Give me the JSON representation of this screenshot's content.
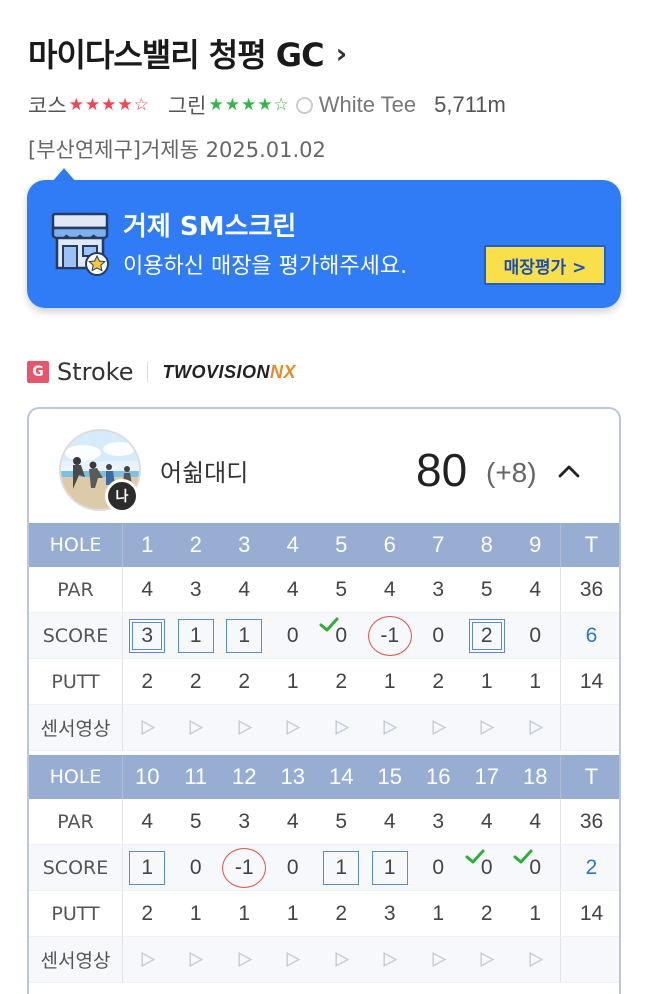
{
  "course": {
    "title": "마이다스밸리 청평 GC",
    "course_label": "코스",
    "course_stars": "★★★★☆",
    "green_label": "그린",
    "green_stars": "★★★★☆",
    "tee": "White Tee",
    "distance": "5,711m",
    "location_date": "[부산연제구]거제동 2025.01.02"
  },
  "banner": {
    "store_name": "거제 SM스크린",
    "message": "이용하신 매장을 평가해주세요.",
    "button_label": "매장평가 >"
  },
  "mode": {
    "badge": "G",
    "label": "Stroke",
    "brand": "TWOVISION",
    "brand_suffix": "NX"
  },
  "player": {
    "name": "어쉶대디",
    "badge": "나",
    "score": "80",
    "over_par": "(+8)"
  },
  "labels": {
    "hole": "HOLE",
    "par": "PAR",
    "score": "SCORE",
    "putt": "PUTT",
    "video": "센서영상",
    "total": "T"
  },
  "front_nine": {
    "holes": [
      "1",
      "2",
      "3",
      "4",
      "5",
      "6",
      "7",
      "8",
      "9"
    ],
    "par": [
      "4",
      "3",
      "4",
      "4",
      "5",
      "4",
      "3",
      "5",
      "4"
    ],
    "score": [
      "3",
      "1",
      "1",
      "0",
      "0",
      "-1",
      "0",
      "2",
      "0"
    ],
    "score_marks": [
      "double-box",
      "box",
      "box",
      "none",
      "check",
      "circle",
      "none",
      "double-box",
      "none"
    ],
    "putt": [
      "2",
      "2",
      "2",
      "1",
      "2",
      "1",
      "2",
      "1",
      "1"
    ],
    "total_par": "36",
    "total_score": "6",
    "total_putt": "14"
  },
  "back_nine": {
    "holes": [
      "10",
      "11",
      "12",
      "13",
      "14",
      "15",
      "16",
      "17",
      "18"
    ],
    "par": [
      "4",
      "5",
      "3",
      "4",
      "5",
      "4",
      "3",
      "4",
      "4"
    ],
    "score": [
      "1",
      "0",
      "-1",
      "0",
      "1",
      "1",
      "0",
      "0",
      "0"
    ],
    "score_marks": [
      "box",
      "none",
      "circle",
      "none",
      "box",
      "box",
      "none",
      "check",
      "check"
    ],
    "putt": [
      "2",
      "1",
      "1",
      "1",
      "2",
      "3",
      "1",
      "2",
      "1"
    ],
    "total_par": "36",
    "total_score": "2",
    "total_putt": "14"
  },
  "colors": {
    "banner_bg": "#2f7cf6",
    "button_bg": "#f9e04a",
    "header_bg": "#97aed2",
    "star_red": "#ef4552",
    "star_green": "#38b54a",
    "circle_red": "#e0514f",
    "box_blue": "#5a8ad0",
    "check_green": "#2fae3c",
    "total_blue": "#2b76d6"
  }
}
